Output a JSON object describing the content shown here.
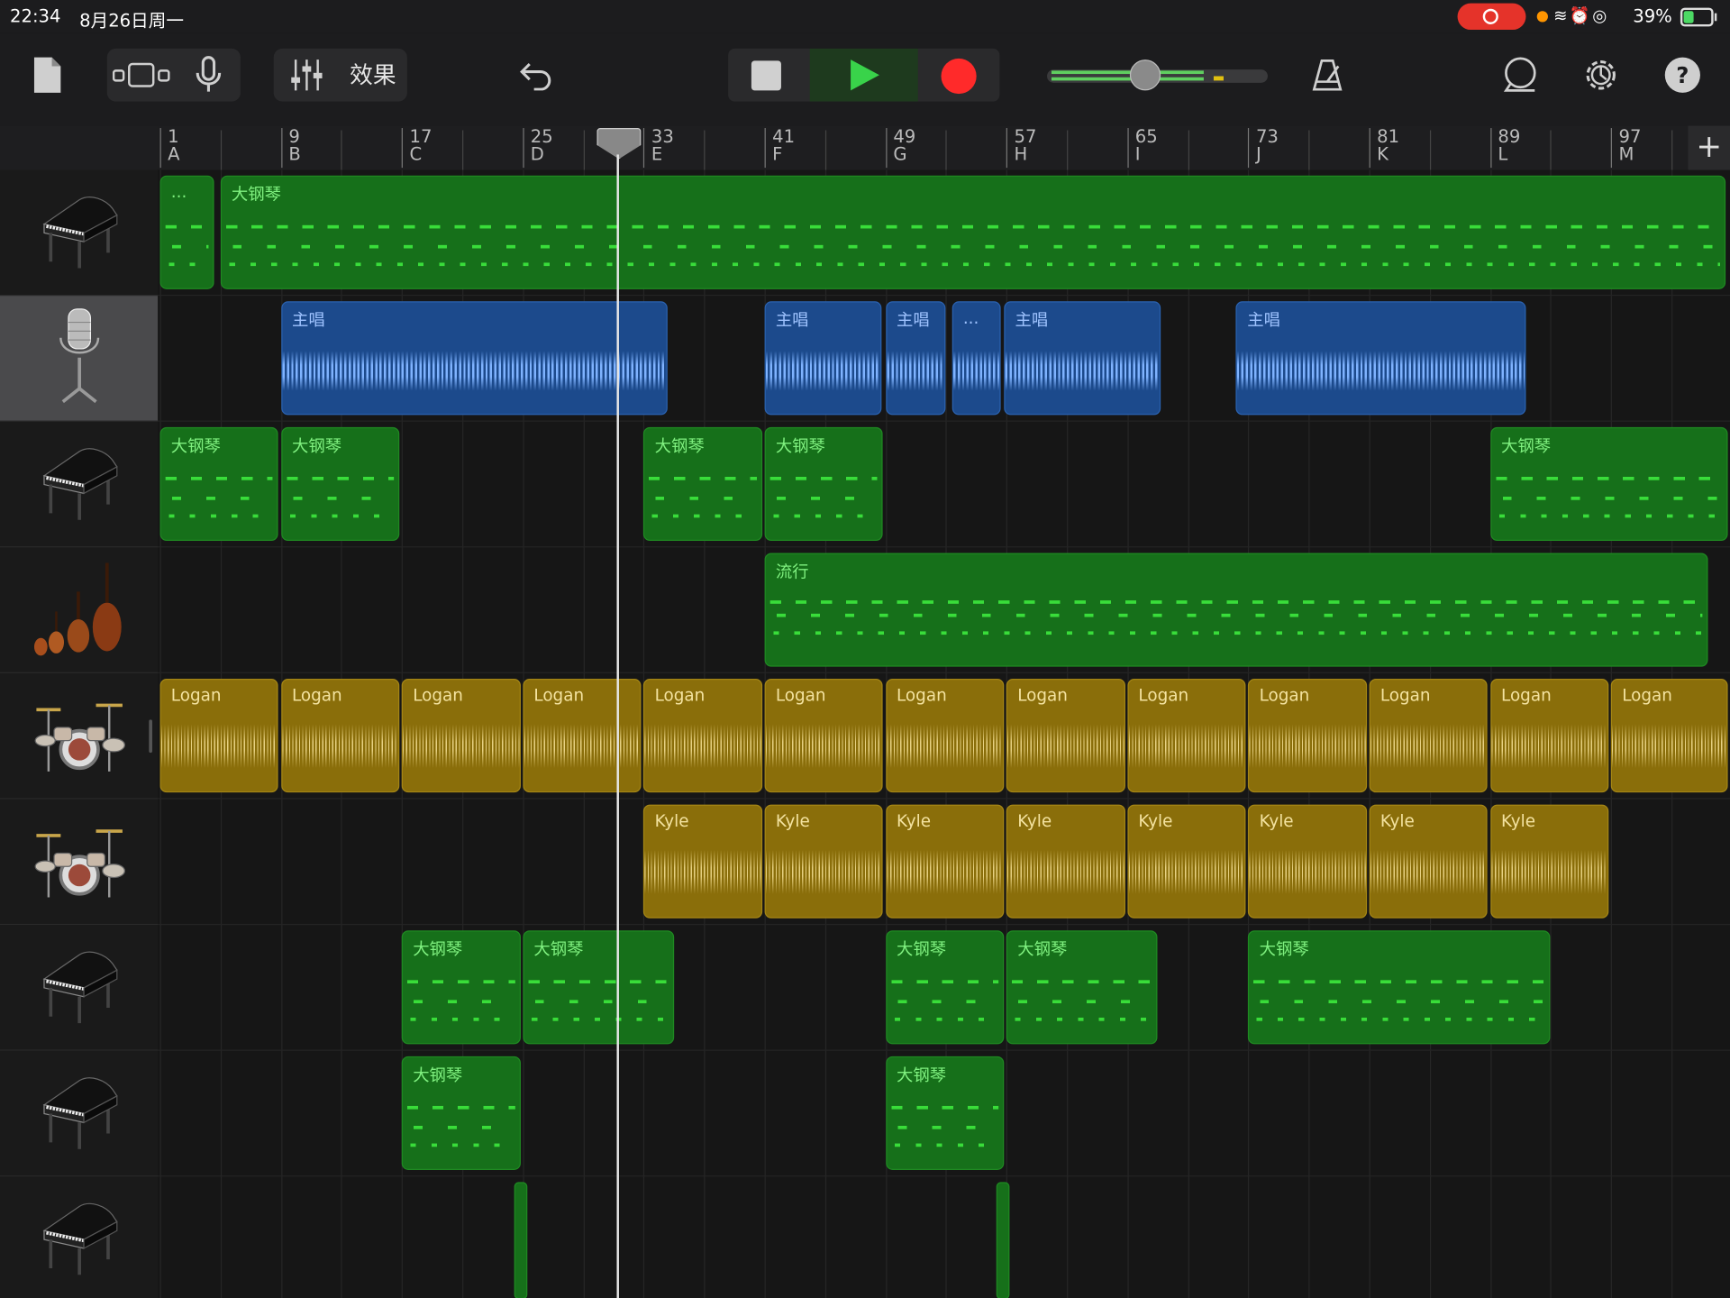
{
  "status": {
    "time": "22:34",
    "date": "8月26日周一",
    "battery": "39%"
  },
  "toolbar": {
    "effects_label": "效果"
  },
  "ruler": {
    "bars": [
      {
        "num": "1",
        "sec": "A"
      },
      {
        "num": "9",
        "sec": "B"
      },
      {
        "num": "17",
        "sec": "C"
      },
      {
        "num": "25",
        "sec": "D"
      },
      {
        "num": "33",
        "sec": "E"
      },
      {
        "num": "41",
        "sec": "F"
      },
      {
        "num": "49",
        "sec": "G"
      },
      {
        "num": "57",
        "sec": "H"
      },
      {
        "num": "65",
        "sec": "I"
      },
      {
        "num": "73",
        "sec": "J"
      },
      {
        "num": "81",
        "sec": "K"
      },
      {
        "num": "89",
        "sec": "L"
      },
      {
        "num": "97",
        "sec": "M"
      }
    ],
    "add_label": "+"
  },
  "tracks": [
    {
      "instrument": "grand-piano",
      "selected": false,
      "regions": [
        {
          "label": "...",
          "type": "midi",
          "start": 0,
          "span": 0.45
        },
        {
          "label": "大钢琴",
          "type": "midi",
          "start": 0.5,
          "span": 12.45
        }
      ]
    },
    {
      "instrument": "vocal-microphone",
      "selected": true,
      "regions": [
        {
          "label": "主唱",
          "type": "audio",
          "start": 1,
          "span": 3.2
        },
        {
          "label": "主唱",
          "type": "audio",
          "start": 5,
          "span": 0.97
        },
        {
          "label": "主唱",
          "type": "audio",
          "start": 6,
          "span": 0.5
        },
        {
          "label": "...",
          "type": "audio",
          "start": 6.55,
          "span": 0.4
        },
        {
          "label": "主唱",
          "type": "audio",
          "start": 6.98,
          "span": 1.3
        },
        {
          "label": "主唱",
          "type": "audio",
          "start": 8.9,
          "span": 2.4
        }
      ]
    },
    {
      "instrument": "grand-piano",
      "selected": false,
      "regions": [
        {
          "label": "大钢琴",
          "type": "midi",
          "start": 0,
          "span": 0.98
        },
        {
          "label": "大钢琴",
          "type": "midi",
          "start": 1,
          "span": 0.98
        },
        {
          "label": "大钢琴",
          "type": "midi",
          "start": 4,
          "span": 0.98
        },
        {
          "label": "大钢琴",
          "type": "midi",
          "start": 5,
          "span": 0.98
        },
        {
          "label": "大钢琴",
          "type": "midi",
          "start": 11,
          "span": 2.1
        }
      ]
    },
    {
      "instrument": "strings",
      "selected": false,
      "regions": [
        {
          "label": "流行",
          "type": "midi-dense",
          "start": 5,
          "span": 7.8
        }
      ]
    },
    {
      "instrument": "drum-kit",
      "selected": false,
      "regions": [
        {
          "label": "Logan",
          "type": "drum",
          "start": 0,
          "span": 0.98
        },
        {
          "label": "Logan",
          "type": "drum",
          "start": 1,
          "span": 0.98
        },
        {
          "label": "Logan",
          "type": "drum",
          "start": 2,
          "span": 0.98
        },
        {
          "label": "Logan",
          "type": "drum",
          "start": 3,
          "span": 0.98
        },
        {
          "label": "Logan",
          "type": "drum",
          "start": 4,
          "span": 0.98
        },
        {
          "label": "Logan",
          "type": "drum",
          "start": 5,
          "span": 0.98
        },
        {
          "label": "Logan",
          "type": "drum",
          "start": 6,
          "span": 0.98
        },
        {
          "label": "Logan",
          "type": "drum",
          "start": 7,
          "span": 0.98
        },
        {
          "label": "Logan",
          "type": "drum",
          "start": 8,
          "span": 0.98
        },
        {
          "label": "Logan",
          "type": "drum",
          "start": 9,
          "span": 0.98
        },
        {
          "label": "Logan",
          "type": "drum",
          "start": 10,
          "span": 0.98
        },
        {
          "label": "Logan",
          "type": "drum",
          "start": 11,
          "span": 0.98
        },
        {
          "label": "Logan",
          "type": "drum",
          "start": 12,
          "span": 1.0
        }
      ]
    },
    {
      "instrument": "drum-kit",
      "selected": false,
      "regions": [
        {
          "label": "Kyle",
          "type": "drum",
          "start": 4,
          "span": 0.98
        },
        {
          "label": "Kyle",
          "type": "drum",
          "start": 5,
          "span": 0.98
        },
        {
          "label": "Kyle",
          "type": "drum",
          "start": 6,
          "span": 0.98
        },
        {
          "label": "Kyle",
          "type": "drum",
          "start": 7,
          "span": 0.98
        },
        {
          "label": "Kyle",
          "type": "drum",
          "start": 8,
          "span": 0.98
        },
        {
          "label": "Kyle",
          "type": "drum",
          "start": 9,
          "span": 0.98
        },
        {
          "label": "Kyle",
          "type": "drum",
          "start": 10,
          "span": 0.98
        },
        {
          "label": "Kyle",
          "type": "drum",
          "start": 11,
          "span": 0.98
        }
      ]
    },
    {
      "instrument": "grand-piano",
      "selected": false,
      "regions": [
        {
          "label": "大钢琴",
          "type": "midi",
          "start": 2,
          "span": 0.98
        },
        {
          "label": "大钢琴",
          "type": "midi",
          "start": 3,
          "span": 1.25
        },
        {
          "label": "大钢琴",
          "type": "midi",
          "start": 6,
          "span": 0.98
        },
        {
          "label": "大钢琴",
          "type": "midi",
          "start": 7,
          "span": 1.25
        },
        {
          "label": "大钢琴",
          "type": "midi",
          "start": 9,
          "span": 2.5
        }
      ]
    },
    {
      "instrument": "grand-piano",
      "selected": false,
      "regions": [
        {
          "label": "大钢琴",
          "type": "midi",
          "start": 2,
          "span": 0.98
        },
        {
          "label": "大钢琴",
          "type": "midi",
          "start": 6,
          "span": 0.98
        }
      ]
    },
    {
      "instrument": "grand-piano",
      "selected": false,
      "regions": [
        {
          "label": "",
          "type": "thin",
          "start": 2.93,
          "span": 0.11
        },
        {
          "label": "",
          "type": "thin",
          "start": 6.92,
          "span": 0.11
        }
      ]
    }
  ]
}
